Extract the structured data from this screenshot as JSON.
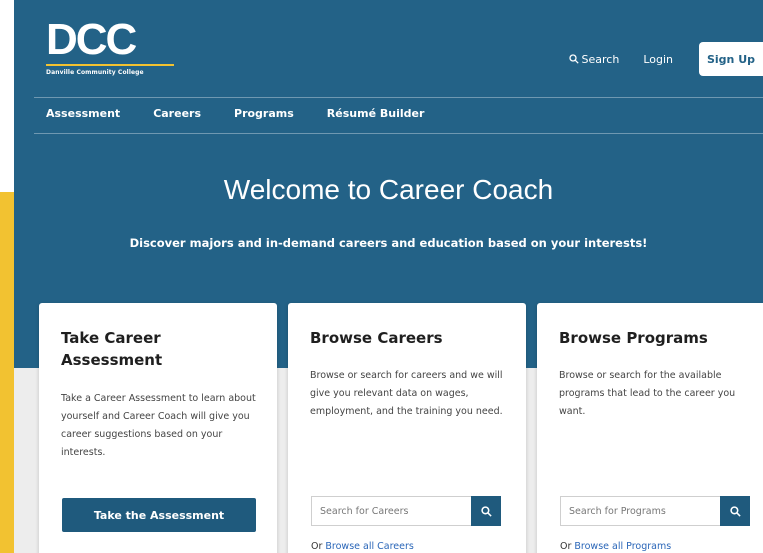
{
  "logo": {
    "mark": "DCC",
    "subtitle": "Danville Community College"
  },
  "topnav": {
    "search_label": "Search",
    "login_label": "Login",
    "signup_label": "Sign Up"
  },
  "mainnav": [
    "Assessment",
    "Careers",
    "Programs",
    "Résumé Builder"
  ],
  "hero": {
    "title": "Welcome to Career Coach",
    "subtitle": "Discover majors and in-demand careers and education based on your interests!"
  },
  "cards": [
    {
      "title": "Take Career Assessment",
      "description": "Take a Career Assessment to learn about yourself and Career Coach will give you career suggestions based on your interests.",
      "button_label": "Take the Assessment"
    },
    {
      "title": "Browse Careers",
      "description": "Browse or search for careers and we will give you relevant data on wages, employment, and the training you need.",
      "search_placeholder": "Search for Careers",
      "browse_prefix": "Or ",
      "browse_link": "Browse all Careers"
    },
    {
      "title": "Browse Programs",
      "description": "Browse or search for the available programs that lead to the career you want.",
      "search_placeholder": "Search for Programs",
      "browse_prefix": "Or ",
      "browse_link": "Browse all Programs"
    }
  ],
  "colors": {
    "brand_blue": "#236287",
    "accent_yellow": "#f2c231",
    "button_blue": "#1f5a7d",
    "link_blue": "#2a66b8"
  },
  "icons": {
    "search": "search-icon"
  }
}
